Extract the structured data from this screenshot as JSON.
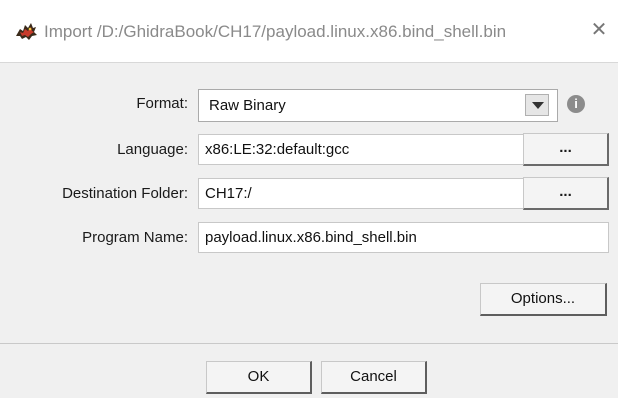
{
  "window": {
    "title": "Import /D:/GhidraBook/CH17/payload.linux.x86.bind_shell.bin",
    "close_glyph": "✕"
  },
  "form": {
    "format": {
      "label": "Format:",
      "value": "Raw Binary"
    },
    "language": {
      "label": "Language:",
      "value": "x86:LE:32:default:gcc",
      "browse_label": "..."
    },
    "destination_folder": {
      "label": "Destination Folder:",
      "value": "CH17:/",
      "browse_label": "..."
    },
    "program_name": {
      "label": "Program Name:",
      "value": "payload.linux.x86.bind_shell.bin"
    }
  },
  "info_icon_glyph": "i",
  "buttons": {
    "options_label": "Options...",
    "ok_label": "OK",
    "cancel_label": "Cancel"
  },
  "icons": {
    "app": "ghidra-dragon-icon",
    "format_dropdown": "chevron-down-icon",
    "format_info": "info-icon",
    "close": "close-icon"
  }
}
